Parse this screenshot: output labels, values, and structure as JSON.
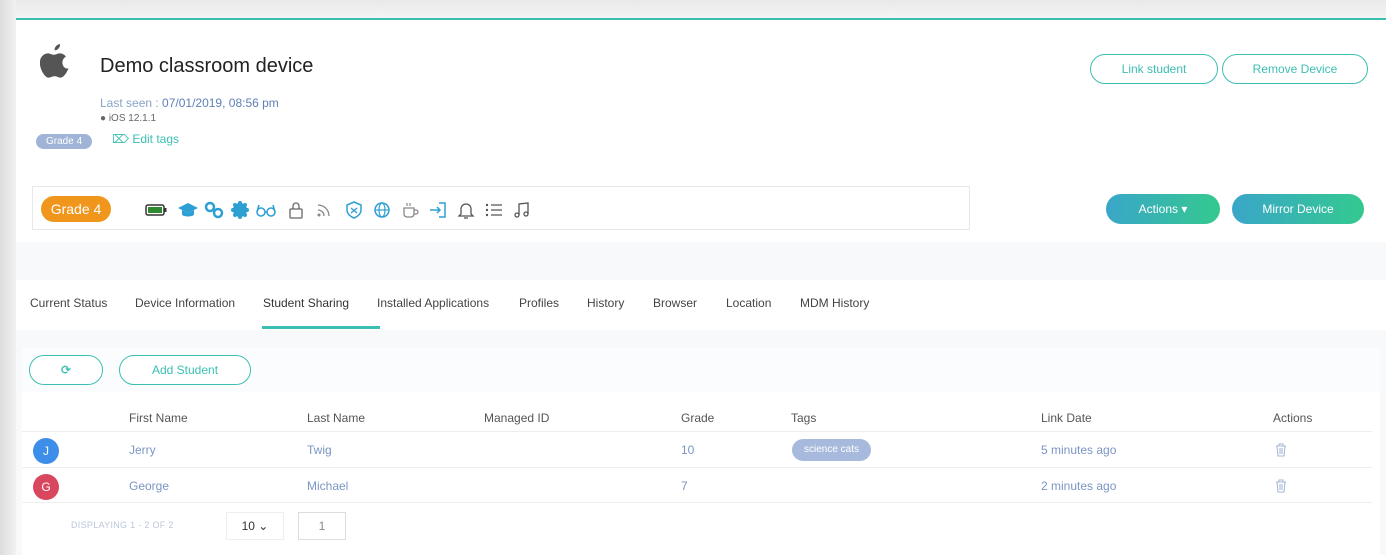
{
  "device": {
    "title": "Demo classroom device",
    "last_seen_label": "Last seen : ",
    "last_seen_value": "07/01/2019, 08:56 pm",
    "os": " iOS 12.1.1",
    "grade_tag": "Grade 4",
    "edit_tags": "Edit tags"
  },
  "header_buttons": {
    "link_student": "Link student",
    "remove_device": "Remove Device"
  },
  "toolbar": {
    "grade_badge": "Grade 4",
    "icons": [
      "battery-icon",
      "graduation-cap-icon",
      "link-icon",
      "gear-badge-icon",
      "glasses-icon",
      "lock-icon",
      "rss-icon",
      "shield-icon",
      "globe-icon",
      "coffee-icon",
      "sign-in-icon",
      "bell-icon",
      "list-icon",
      "music-icon"
    ],
    "actions": "Actions ▾",
    "mirror": "Mirror Device"
  },
  "tabs": [
    "Current Status",
    "Device Information",
    "Student Sharing",
    "Installed Applications",
    "Profiles",
    "History",
    "Browser",
    "Location",
    "MDM History"
  ],
  "active_tab": "Student Sharing",
  "panel": {
    "add_student": "Add Student"
  },
  "table": {
    "headers": [
      "First Name",
      "Last Name",
      "Managed ID",
      "Grade",
      "Tags",
      "Link Date",
      "Actions"
    ],
    "rows": [
      {
        "initial": "J",
        "avatar_color": "#3d8ee8",
        "first": "Jerry",
        "last": "Twig",
        "managed_id": "",
        "grade": "10",
        "tag": "science cats",
        "link_date": "5 minutes ago"
      },
      {
        "initial": "G",
        "avatar_color": "#d9475e",
        "first": "George",
        "last": "Michael",
        "managed_id": "",
        "grade": "7",
        "tag": "",
        "link_date": "2 minutes ago"
      }
    ]
  },
  "pagination": {
    "displaying": "DISPLAYING 1 - 2 OF 2",
    "page_size": "10 ⌄",
    "page": "1"
  },
  "colors": {
    "accent": "#3cbfb3",
    "orange": "#f0961c"
  }
}
